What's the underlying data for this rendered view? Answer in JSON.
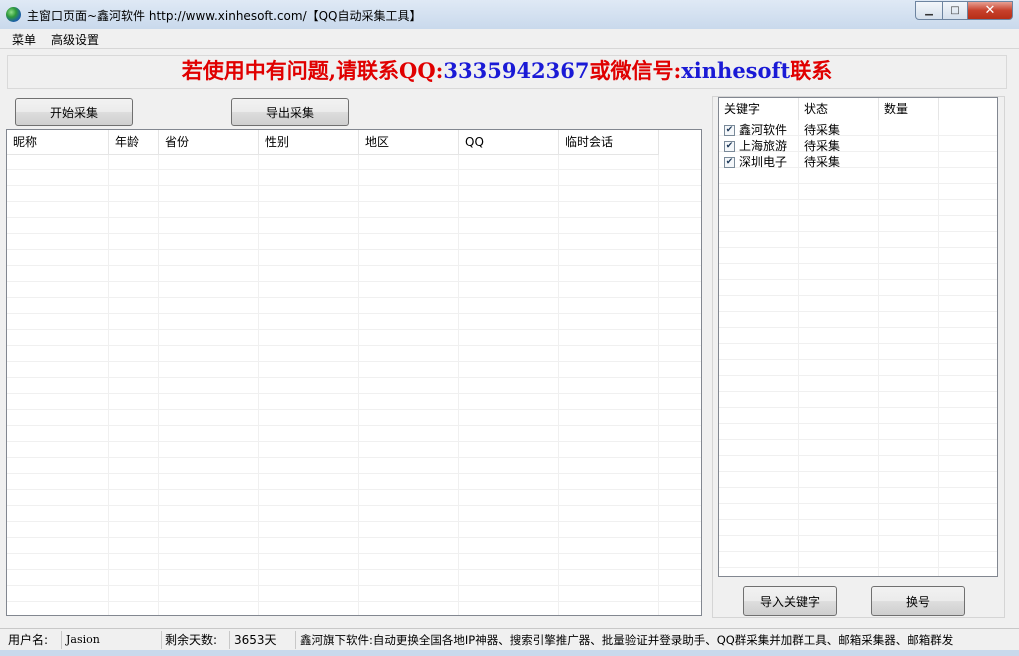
{
  "window": {
    "title": "主窗口页面~鑫河软件 http://www.xinhesoft.com/【QQ自动采集工具】",
    "min_glyph": "▁",
    "max_glyph": "□",
    "close_glyph": "✕"
  },
  "menu": [
    "菜单",
    "高级设置"
  ],
  "banner": {
    "part1": "若使用中有问题,请联系QQ:",
    "qq": "3335942367",
    "part2": "或微信号:",
    "wechat": "xinhesoft",
    "part3": "联系"
  },
  "buttons": {
    "start": "开始采集",
    "export": "导出采集",
    "import_keywords": "导入关键字",
    "switch_account": "换号"
  },
  "left_table": {
    "columns": [
      "昵称",
      "年龄",
      "省份",
      "性别",
      "地区",
      "QQ",
      "临时会话"
    ],
    "rows": []
  },
  "right_table": {
    "columns": [
      "关键字",
      "状态",
      "数量"
    ],
    "rows": [
      {
        "checked": true,
        "keyword": "鑫河软件",
        "status": "待采集",
        "count": ""
      },
      {
        "checked": true,
        "keyword": "上海旅游",
        "status": "待采集",
        "count": ""
      },
      {
        "checked": true,
        "keyword": "深圳电子",
        "status": "待采集",
        "count": ""
      }
    ]
  },
  "status": {
    "user_label": "用户名:",
    "user_value": "Jasion",
    "days_label": "剩余天数:",
    "days_value": "3653天",
    "info": "鑫河旗下软件:自动更换全国各地IP神器、搜索引擎推广器、批量验证并登录助手、QQ群采集并加群工具、邮箱采集器、邮箱群发"
  }
}
